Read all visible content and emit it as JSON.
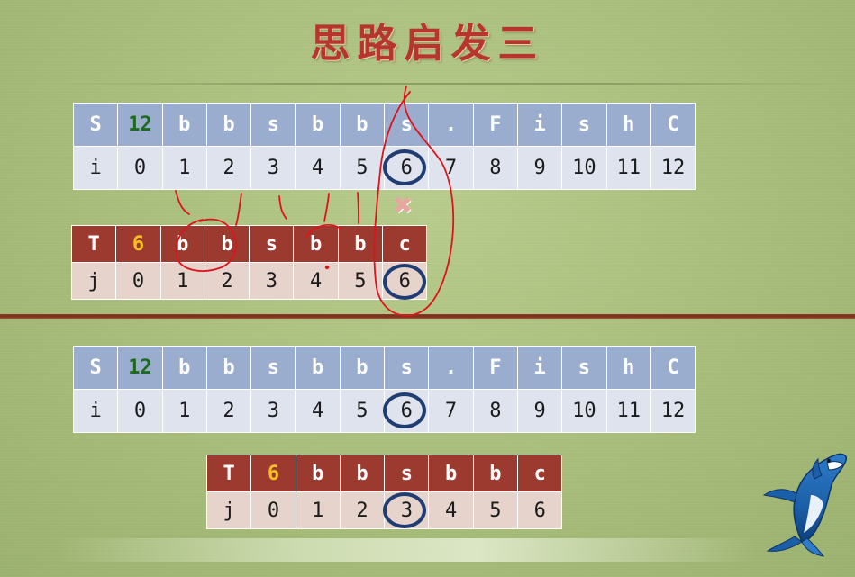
{
  "title": "思路启发三",
  "top": {
    "s_header": [
      "S",
      "12",
      "b",
      "b",
      "s",
      "b",
      "b",
      "s",
      ".",
      "F",
      "i",
      "s",
      "h",
      "C"
    ],
    "s_index": [
      "i",
      "0",
      "1",
      "2",
      "3",
      "4",
      "5",
      "6",
      "7",
      "8",
      "9",
      "10",
      "11",
      "12"
    ],
    "t_header": [
      "T",
      "6",
      "b",
      "b",
      "s",
      "b",
      "b",
      "c"
    ],
    "t_index": [
      "j",
      "0",
      "1",
      "2",
      "3",
      "4",
      "5",
      "6"
    ],
    "mismatch_mark": "✖"
  },
  "bottom": {
    "s_header": [
      "S",
      "12",
      "b",
      "b",
      "s",
      "b",
      "b",
      "s",
      ".",
      "F",
      "i",
      "s",
      "h",
      "C"
    ],
    "s_index": [
      "i",
      "0",
      "1",
      "2",
      "3",
      "4",
      "5",
      "6",
      "7",
      "8",
      "9",
      "10",
      "11",
      "12"
    ],
    "t_header": [
      "T",
      "6",
      "b",
      "b",
      "s",
      "b",
      "b",
      "c"
    ],
    "t_index": [
      "j",
      "0",
      "1",
      "2",
      "3",
      "4",
      "5",
      "6"
    ]
  },
  "colors": {
    "s_header_bg": "#9badcf",
    "t_header_bg": "#9c3a30",
    "title": "#b6362f",
    "divider": "#7a2f1d",
    "circle": "#203d73",
    "annotation": "#e0121b"
  }
}
